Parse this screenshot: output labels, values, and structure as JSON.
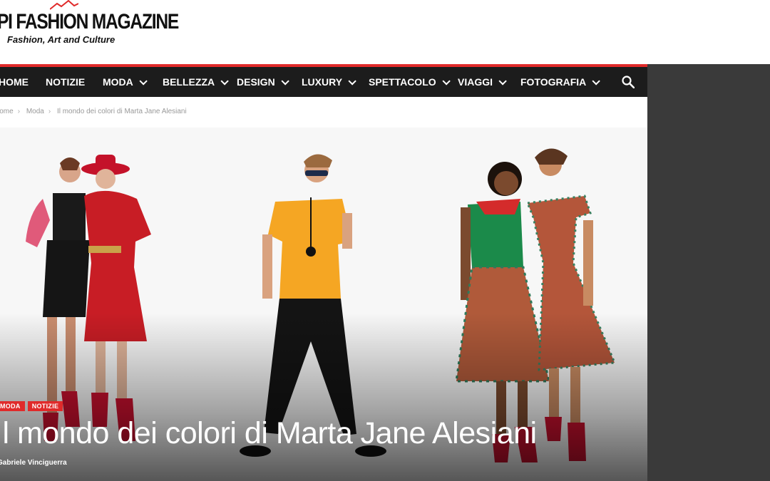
{
  "logo": {
    "title": "PI FASHION MAGAZINE",
    "tagline": "Fashion, Art and Culture"
  },
  "nav": {
    "items": [
      {
        "label": "HOME",
        "dropdown": false
      },
      {
        "label": "NOTIZIE",
        "dropdown": false
      },
      {
        "label": "MODA",
        "dropdown": true
      },
      {
        "label": "BELLEZZA",
        "dropdown": true
      },
      {
        "label": "DESIGN",
        "dropdown": true
      },
      {
        "label": "LUXURY",
        "dropdown": true
      },
      {
        "label": "SPETTACOLO",
        "dropdown": true
      },
      {
        "label": "VIAGGI",
        "dropdown": true
      },
      {
        "label": "FOTOGRAFIA",
        "dropdown": true
      }
    ],
    "search_icon": "search-icon"
  },
  "breadcrumb": [
    "Home",
    "Moda",
    "Il mondo dei colori di Marta Jane Alesiani"
  ],
  "article": {
    "categories": [
      "MODA",
      "NOTIZIE"
    ],
    "title": "Il mondo dei colori di Marta Jane Alesiani",
    "author": "Gabriele Vinciguerra"
  },
  "colors": {
    "accent": "#e02a2a",
    "nav_bg": "#1c1c1c",
    "side_panel": "#3a3a3a"
  }
}
